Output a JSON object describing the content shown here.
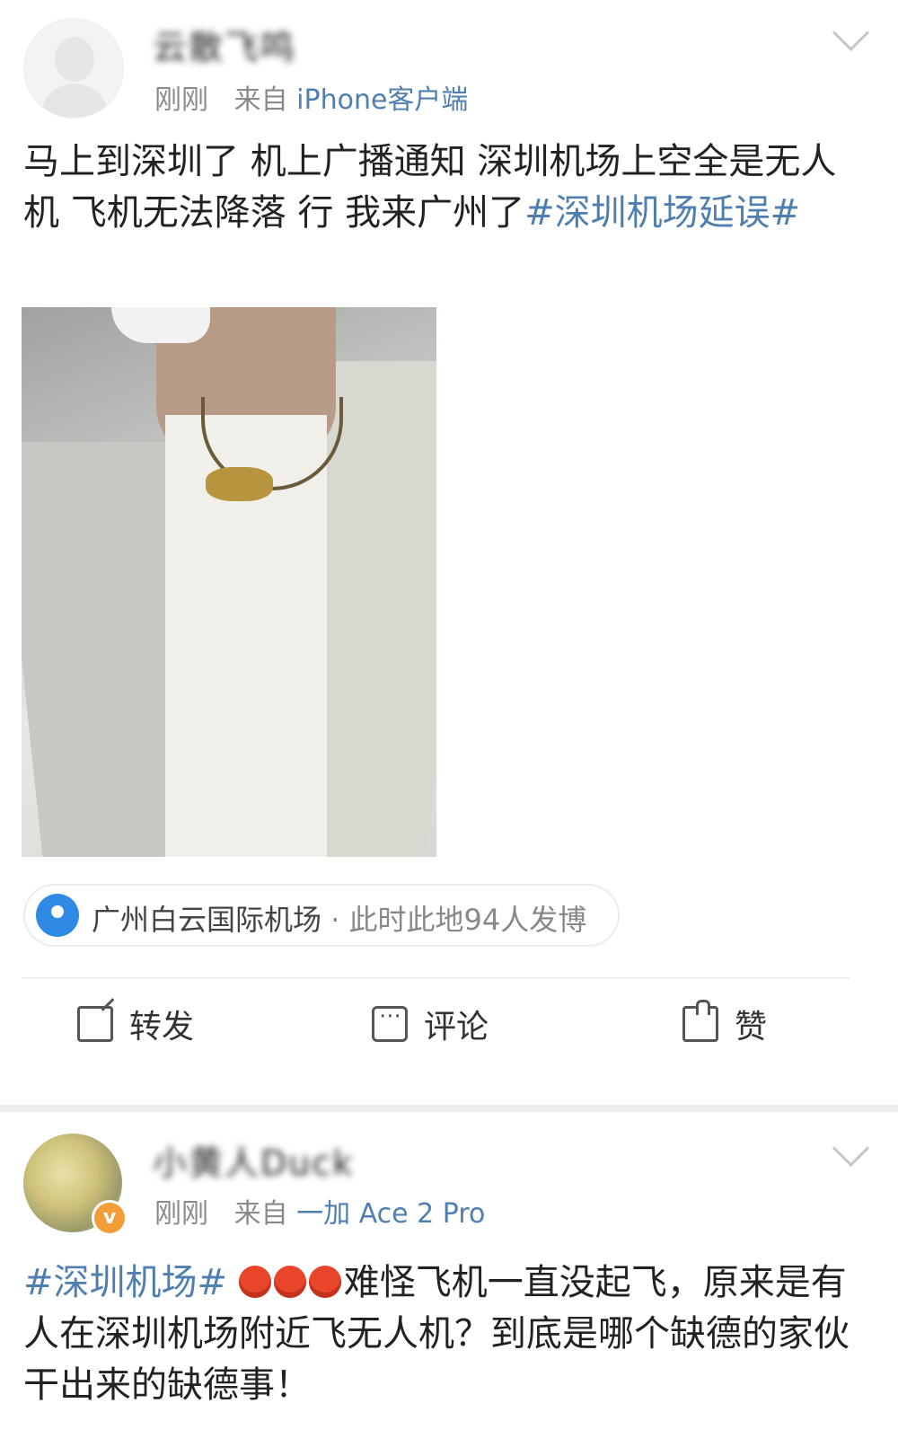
{
  "post1": {
    "username": "云散飞鸣",
    "time": "刚刚",
    "from_prefix": "来自",
    "source": "iPhone客户端",
    "text_plain": "马上到深圳了 机上广播通知 深圳机场上空全是无人机 飞机无法降落 行 我来广州了",
    "hashtag": "#深圳机场延误#",
    "location_name": "广州白云国际机场",
    "location_sub": " · 此时此地94人发博",
    "actions": {
      "repost": "转发",
      "comment": "评论",
      "like": "赞"
    }
  },
  "post2": {
    "username": "小黄人Duck",
    "time": "刚刚",
    "from_prefix": "来自",
    "source": "一加 Ace 2 Pro",
    "hashtag": "#深圳机场#",
    "text_plain": "难怪飞机一直没起飞，原来是有人在深圳机场附近飞无人机？到底是哪个缺德的家伙干出来的缺德事！"
  },
  "colors": {
    "link": "#4f7fb0",
    "location_pin": "#2f8ae6",
    "verified": "#f29d38"
  }
}
